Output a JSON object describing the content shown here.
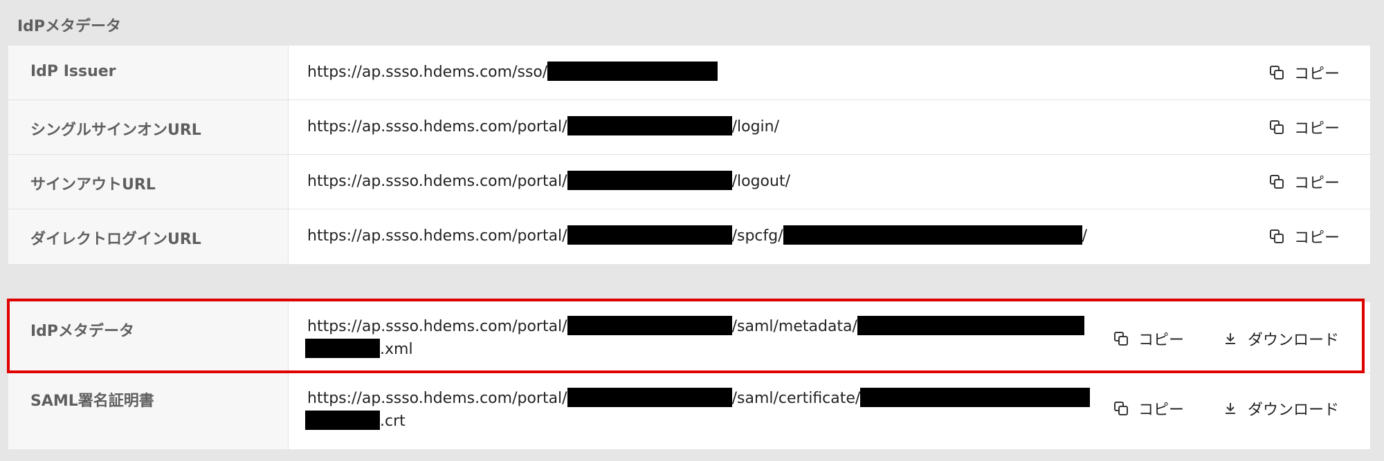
{
  "section_title": "IdPメタデータ",
  "rows": [
    {
      "label": "IdP Issuer",
      "url_prefix": "https://ap.ssso.hdems.com/sso/"
    },
    {
      "label": "シングルサインオンURL",
      "url_prefix": "https://ap.ssso.hdems.com/portal/",
      "url_suffix": "/login/"
    },
    {
      "label": "サインアウトURL",
      "url_prefix": "https://ap.ssso.hdems.com/portal/",
      "url_suffix": "/logout/"
    },
    {
      "label": "ダイレクトログインURL",
      "url_prefix": "https://ap.ssso.hdems.com/portal/",
      "url_mid": "/spcfg/",
      "url_suffix": "/"
    },
    {
      "label": "IdPメタデータ",
      "url_prefix": "https://ap.ssso.hdems.com/portal/",
      "url_mid": "/saml/metadata/",
      "url_line2_suffix": ".xml"
    },
    {
      "label": "SAML署名証明書",
      "url_prefix": "https://ap.ssso.hdems.com/portal/",
      "url_mid": "/saml/certificate/",
      "url_line2_suffix": ".crt"
    }
  ],
  "actions": {
    "copy": "コピー",
    "download": "ダウンロード"
  },
  "colors": {
    "highlight": "#e00000",
    "background": "#e6e6e6",
    "label_bg": "#f7f7f7"
  },
  "icons": {
    "copy": "copy-icon",
    "download": "download-icon"
  }
}
